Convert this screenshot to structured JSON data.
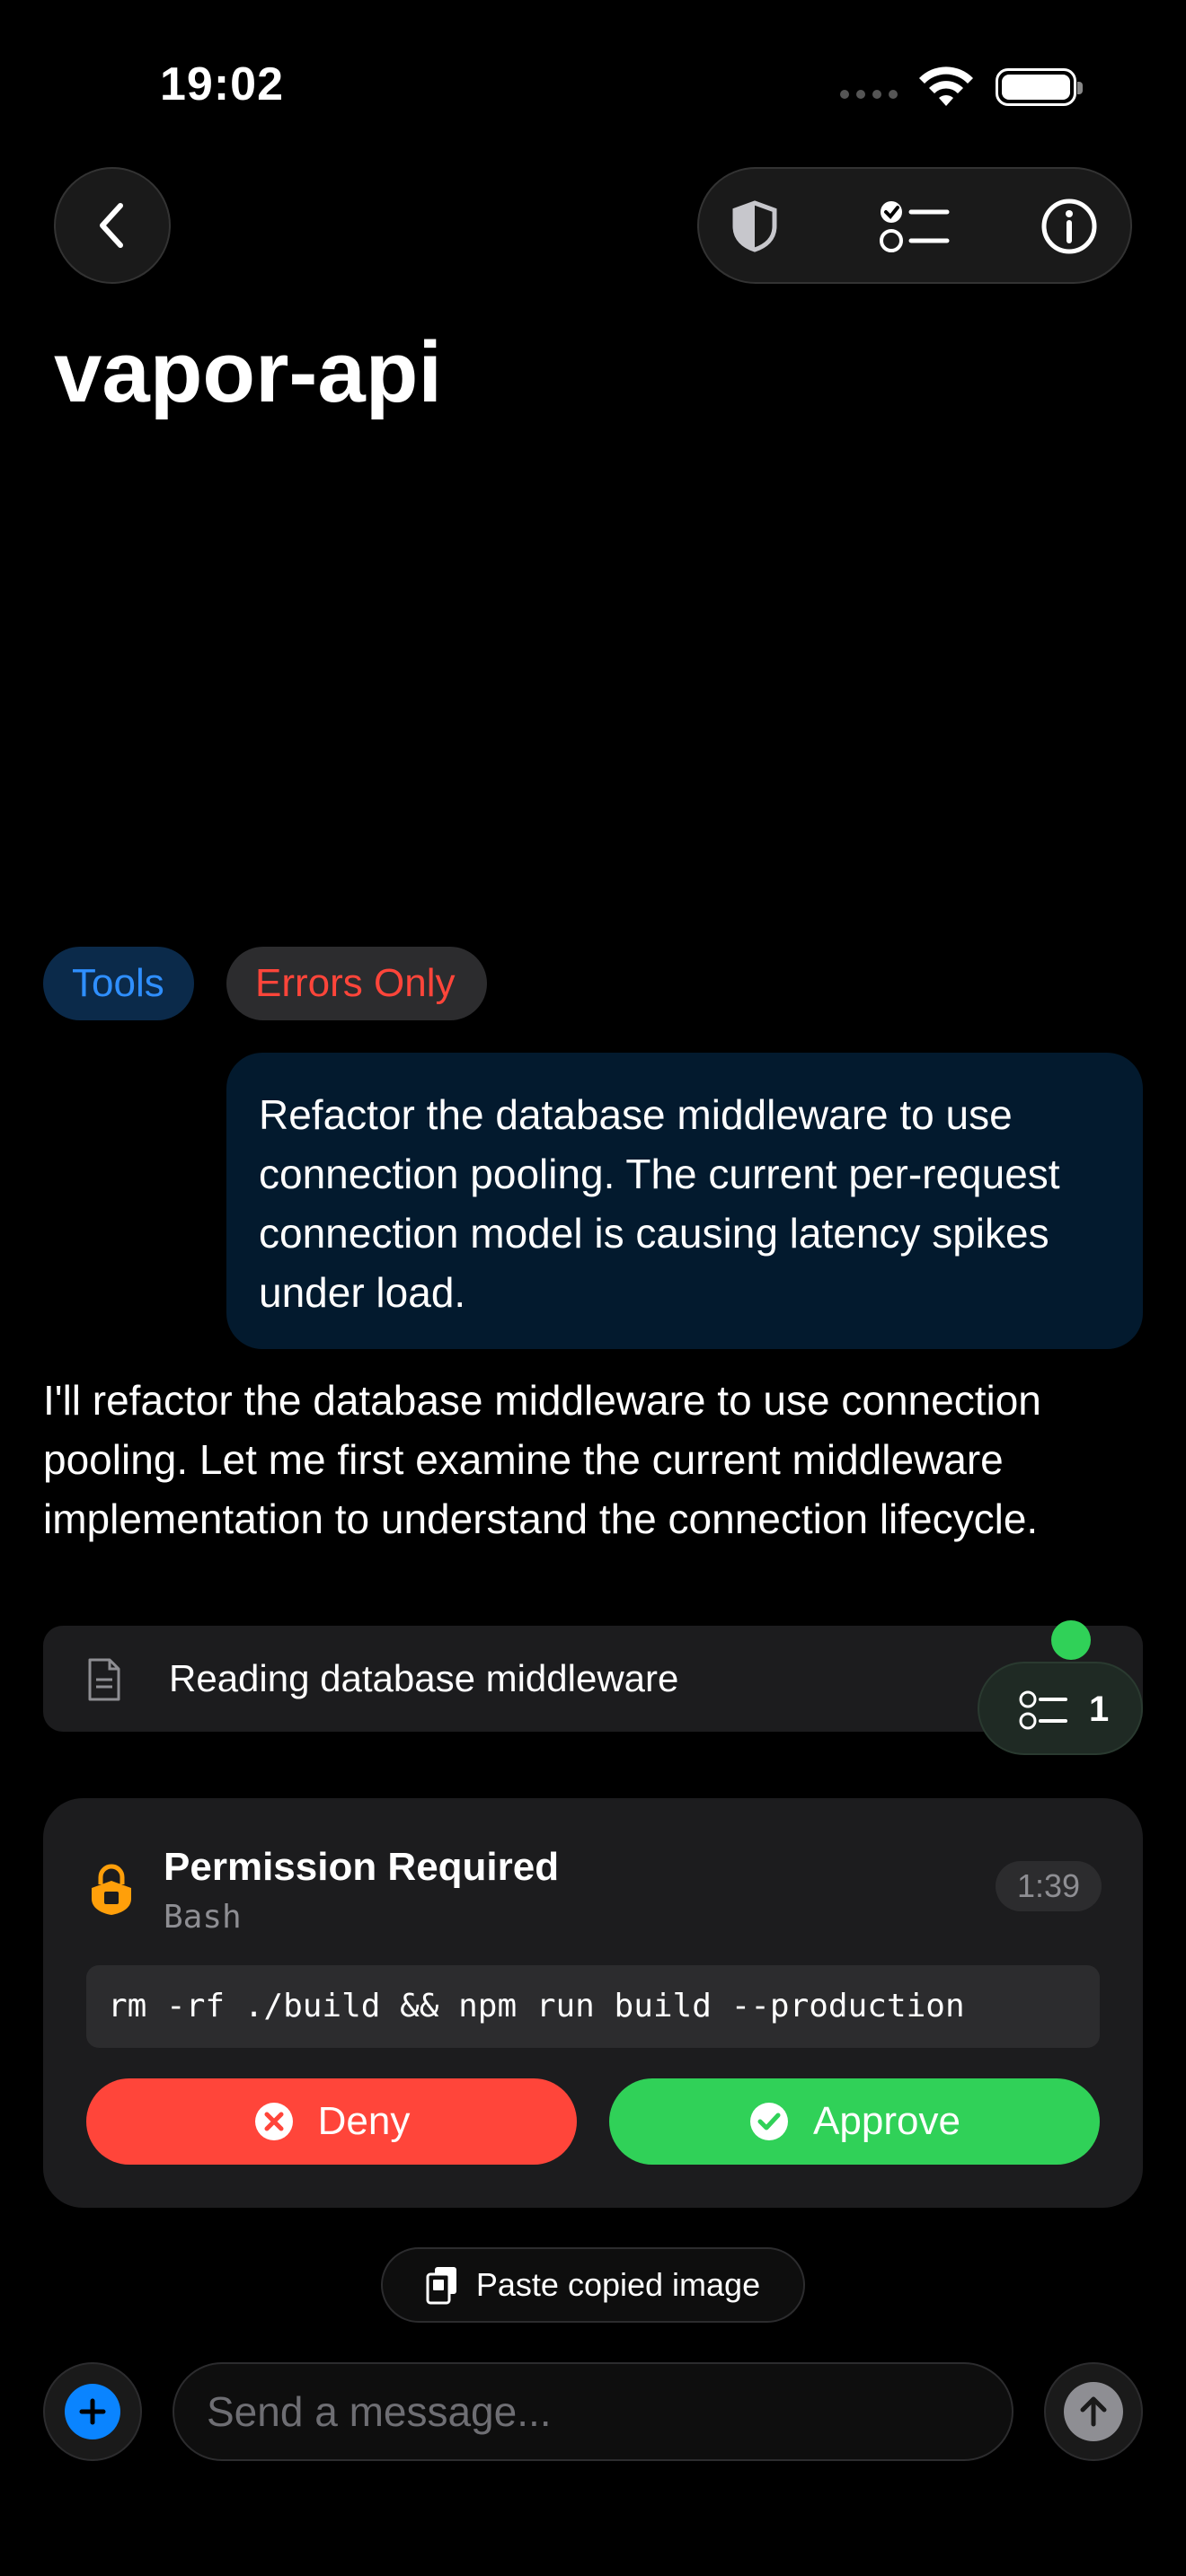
{
  "status_bar": {
    "time": "19:02"
  },
  "header": {
    "title": "vapor-api",
    "back_icon": "chevron-left-icon",
    "toolbar_icons": [
      "shield-icon",
      "checklist-icon",
      "info-icon"
    ]
  },
  "filters": [
    {
      "label": "Tools",
      "color": "#2f8fff"
    },
    {
      "label": "Errors Only",
      "color": "#ff453a"
    }
  ],
  "messages": {
    "user": "Refactor the database middleware to use connection pooling. The current per-request connection model is causing latency spikes under load.",
    "assistant": "I'll refactor the database middleware to use connection pooling. Let me first examine the current middleware implementation to understand the connection lifecycle."
  },
  "tool_call": {
    "label": "Reading database middleware",
    "icon": "document-icon",
    "status_color": "#30d158"
  },
  "task_pill": {
    "count": "1",
    "icon": "checklist-icon"
  },
  "permission": {
    "title": "Permission Required",
    "tool": "Bash",
    "timer": "1:39",
    "command": "rm -rf ./build && npm run build --production",
    "deny_label": "Deny",
    "approve_label": "Approve",
    "deny_color": "#ff453a",
    "approve_color": "#30d158"
  },
  "paste": {
    "label": "Paste copied image",
    "icon": "clipboard-icon"
  },
  "composer": {
    "placeholder": "Send a message...",
    "value": "",
    "accent": "#0a84ff"
  }
}
